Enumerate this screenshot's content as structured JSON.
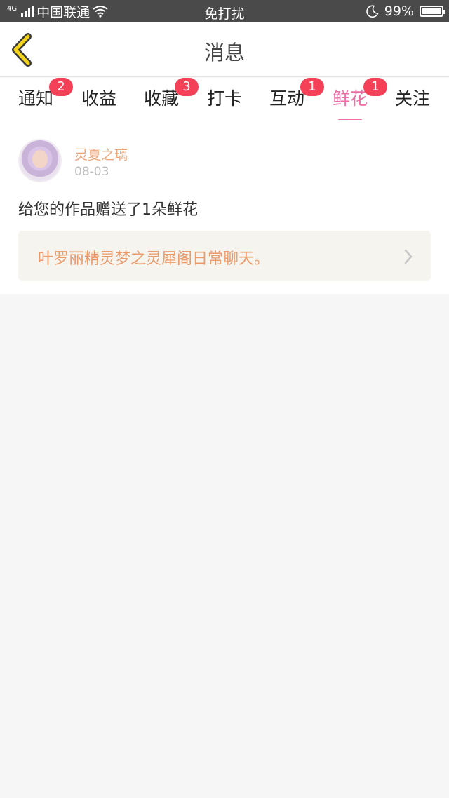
{
  "status_bar": {
    "network_label": "4G",
    "carrier": "中国联通",
    "center_text": "免打扰",
    "battery_percent": "99%",
    "battery_level": 0.99
  },
  "nav": {
    "title": "消息"
  },
  "tabs": [
    {
      "label": "通知",
      "badge": "2"
    },
    {
      "label": "收益",
      "badge": ""
    },
    {
      "label": "收藏",
      "badge": "3"
    },
    {
      "label": "打卡",
      "badge": ""
    },
    {
      "label": "互动",
      "badge": "1"
    },
    {
      "label": "鲜花",
      "badge": "1",
      "active": true
    },
    {
      "label": "关注",
      "badge": ""
    }
  ],
  "notification": {
    "username": "灵夏之璃",
    "date": "08-03",
    "message": "给您的作品赠送了1朵鲜花",
    "work_title": "叶罗丽精灵梦之灵犀阁日常聊天。"
  },
  "colors": {
    "accent_pink": "#ec6fa6",
    "badge_red": "#f44158",
    "username_orange": "#eea57a",
    "back_yellow": "#f3d31b"
  }
}
